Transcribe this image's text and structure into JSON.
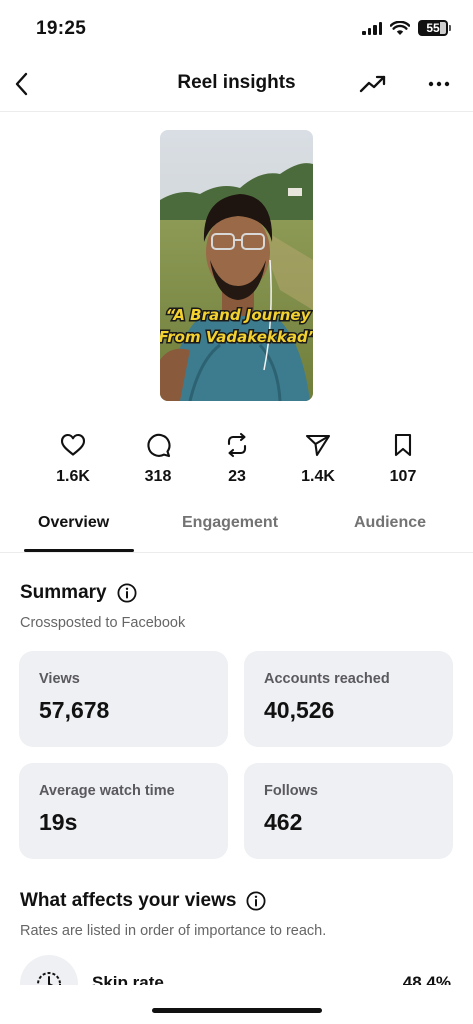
{
  "status_bar": {
    "time": "19:25",
    "battery": "55"
  },
  "nav": {
    "title": "Reel insights"
  },
  "reel": {
    "caption_line1": "“A Brand Journey",
    "caption_line2": "From Vadakekkad”"
  },
  "metrics": [
    {
      "icon": "heart-icon",
      "value": "1.6K"
    },
    {
      "icon": "comment-icon",
      "value": "318"
    },
    {
      "icon": "repost-icon",
      "value": "23"
    },
    {
      "icon": "share-icon",
      "value": "1.4K"
    },
    {
      "icon": "bookmark-icon",
      "value": "107"
    }
  ],
  "tabs": [
    {
      "label": "Overview",
      "active": true
    },
    {
      "label": "Engagement",
      "active": false
    },
    {
      "label": "Audience",
      "active": false
    }
  ],
  "summary": {
    "title": "Summary",
    "subtitle": "Crossposted to Facebook",
    "cards": [
      {
        "label": "Views",
        "value": "57,678"
      },
      {
        "label": "Accounts reached",
        "value": "40,526"
      },
      {
        "label": "Average watch time",
        "value": "19s"
      },
      {
        "label": "Follows",
        "value": "462"
      }
    ]
  },
  "affects": {
    "title": "What affects your views",
    "subtitle": "Rates are listed in order of importance to reach.",
    "rows": [
      {
        "label": "Skip rate",
        "value": "48.4%"
      }
    ]
  }
}
